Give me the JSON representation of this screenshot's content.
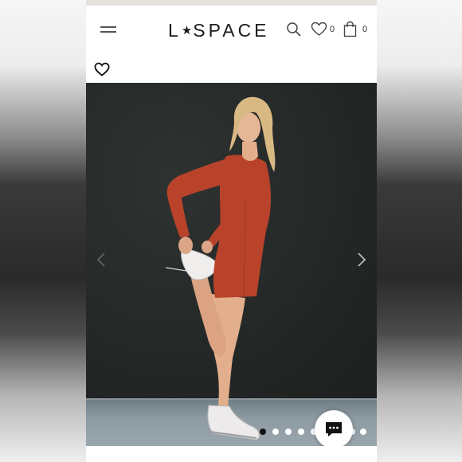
{
  "header": {
    "logo_left": "L",
    "logo_star": "★",
    "logo_right": "SPACE",
    "wishlist_count": "0",
    "cart_count": "0"
  },
  "icons": {
    "menu": "hamburger-menu-icon",
    "search": "search-icon",
    "wishlist": "heart-icon",
    "cart": "shopping-bag-icon",
    "favorite": "heart-outline-icon",
    "prev": "chevron-left-icon",
    "next": "chevron-right-icon",
    "chat": "chat-bubble-icon"
  },
  "gallery": {
    "slide_count": 9,
    "active_index": 1
  },
  "colors": {
    "outfit": "#b9432a",
    "background": "#262a29",
    "accent": "#1a1a1a"
  }
}
